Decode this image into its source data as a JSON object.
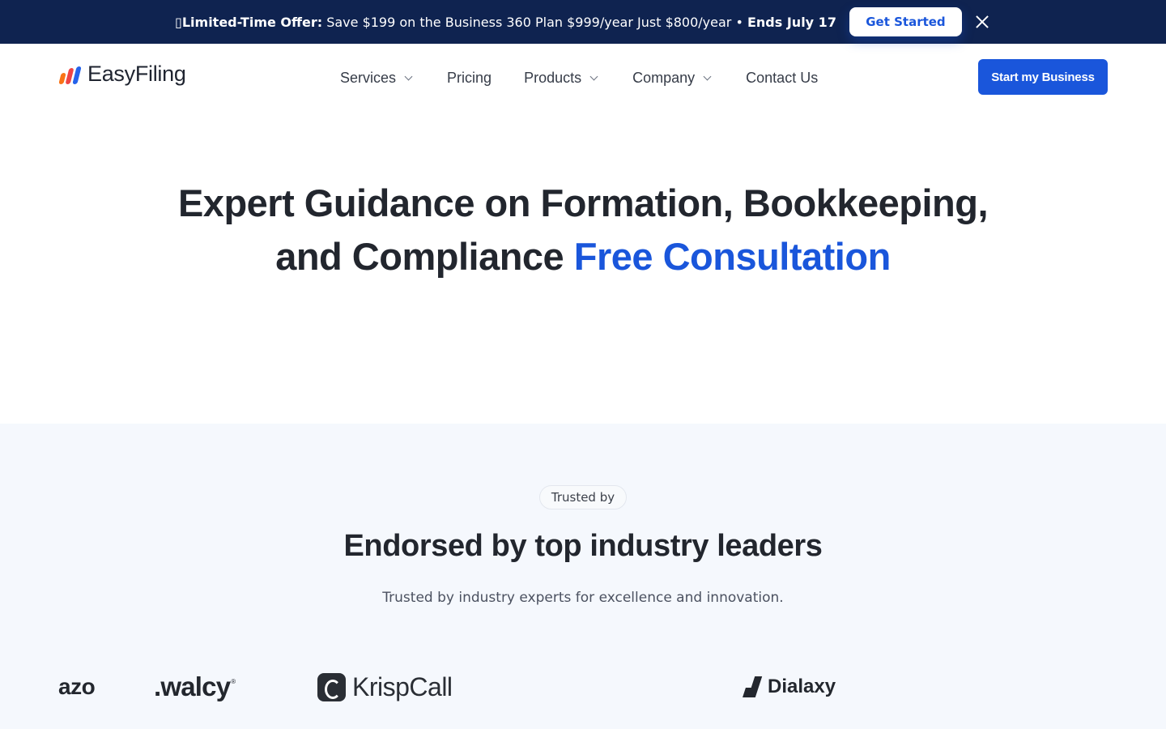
{
  "promo": {
    "icon": "party-emoji",
    "lead": "Limited-Time Offer:",
    "text": " Save $199 on the Business 360 Plan $999/year Just $800/year • ",
    "deadline": "Ends July 17",
    "button_label": "Get Started"
  },
  "header": {
    "brand": "EasyFiling",
    "nav": {
      "services": "Services",
      "pricing": "Pricing",
      "products": "Products",
      "company": "Company",
      "contact": "Contact Us"
    },
    "cta_label": "Start my Business"
  },
  "hero": {
    "title_line1": "Expert Guidance on Formation, Bookkeeping,",
    "title_line2": "and Compliance ",
    "title_accent": "Free Consultation"
  },
  "trusted": {
    "badge": "Trusted by",
    "title": "Endorsed by top industry leaders",
    "subtitle": "Trusted by industry experts for excellence and innovation.",
    "logos": {
      "azo": "azo",
      "walcy": ".walcy",
      "walcy_mark": "®",
      "krispcall": "KrispCall",
      "dialaxy": "Dialaxy"
    }
  },
  "colors": {
    "promo_bg": "#0f2350",
    "accent": "#1a56db",
    "section_bg": "#f5f8fd"
  }
}
